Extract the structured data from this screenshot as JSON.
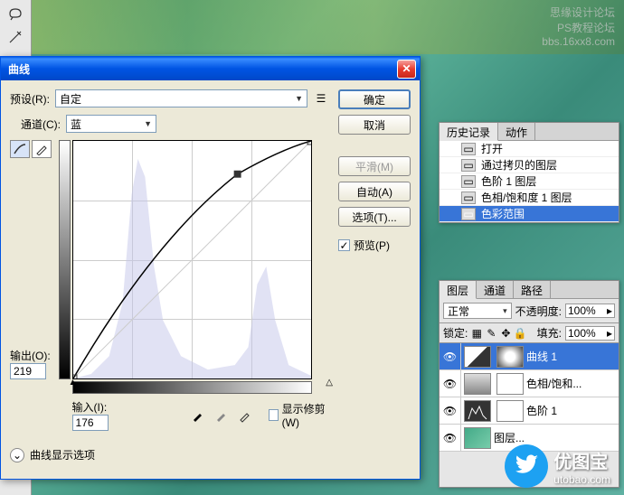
{
  "watermark_top": {
    "line1": "思缘设计论坛",
    "line2": "PS教程论坛",
    "line3": "bbs.16xx8.com"
  },
  "dialog": {
    "title": "曲线",
    "preset_label": "预设(R):",
    "preset_value": "自定",
    "channel_label": "通道(C):",
    "channel_value": "蓝",
    "output_label": "输出(O):",
    "output_value": "219",
    "input_label": "输入(I):",
    "input_value": "176",
    "show_clip": "显示修剪(W)",
    "curve_options": "曲线显示选项",
    "ok": "确定",
    "cancel": "取消",
    "smooth": "平滑(M)",
    "auto": "自动(A)",
    "options": "选项(T)...",
    "preview": "预览(P)"
  },
  "history": {
    "tab1": "历史记录",
    "tab2": "动作",
    "items": [
      {
        "label": "打开"
      },
      {
        "label": "通过拷贝的图层"
      },
      {
        "label": "色阶 1 图层"
      },
      {
        "label": "色相/饱和度 1 图层"
      },
      {
        "label": "色彩范围"
      }
    ]
  },
  "layers": {
    "tab1": "图层",
    "tab2": "通道",
    "tab3": "路径",
    "blend": "正常",
    "opacity_label": "不透明度:",
    "opacity": "100%",
    "lock_label": "锁定:",
    "fill_label": "填充:",
    "fill": "100%",
    "items": [
      {
        "label": "曲线 1"
      },
      {
        "label": "色相/饱和..."
      },
      {
        "label": "色阶 1"
      },
      {
        "label": "图层..."
      }
    ]
  },
  "logo": {
    "name": "优图宝",
    "url": "utobao.com"
  },
  "chart_data": {
    "type": "line",
    "title": "Curves adjustment — Blue channel",
    "xlabel": "Input",
    "ylabel": "Output",
    "xlim": [
      0,
      255
    ],
    "ylim": [
      0,
      255
    ],
    "control_points": [
      {
        "x": 0,
        "y": 0
      },
      {
        "x": 176,
        "y": 219
      },
      {
        "x": 255,
        "y": 255
      }
    ],
    "histogram_peaks_x": [
      60,
      70,
      80,
      200,
      210
    ],
    "grid": true
  }
}
